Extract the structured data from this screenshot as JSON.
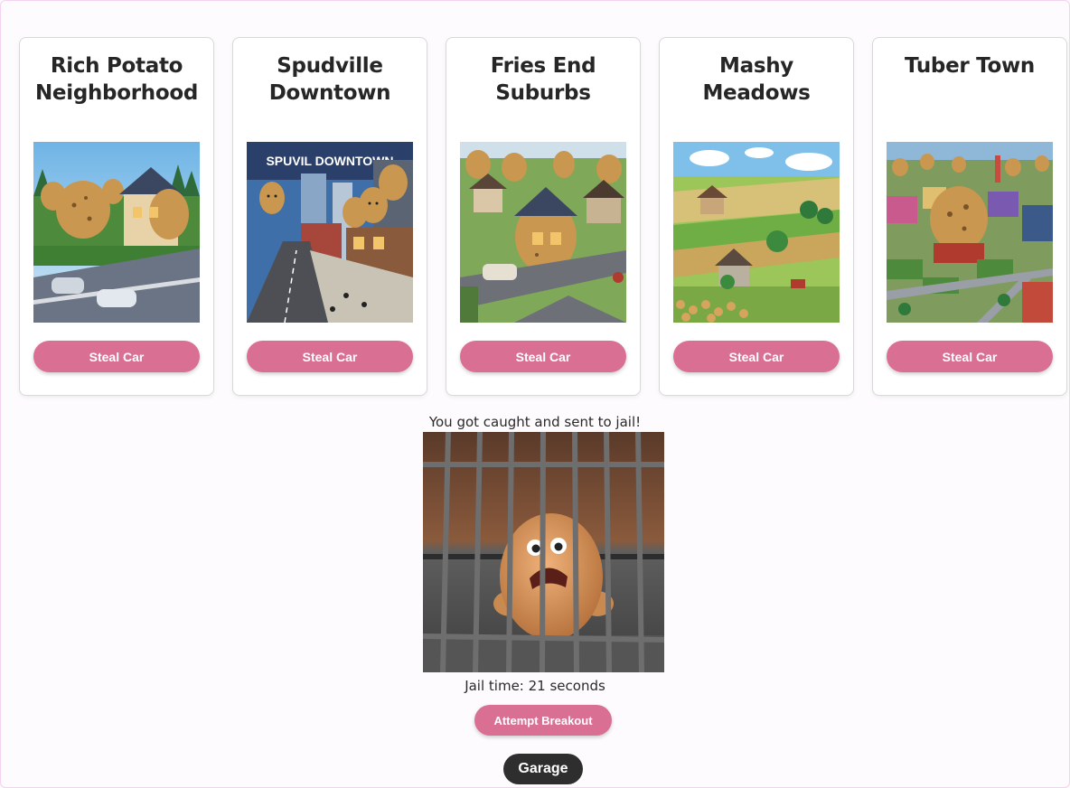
{
  "neighborhoods": [
    {
      "title": "Rich Potato Neighborhood",
      "button": "Steal Car"
    },
    {
      "title": "Spudville Downtown",
      "button": "Steal Car",
      "sign": "SPUVIL DOWNTOWN"
    },
    {
      "title": "Fries End Suburbs",
      "button": "Steal Car"
    },
    {
      "title": "Mashy Meadows",
      "button": "Steal Car"
    },
    {
      "title": "Tuber Town",
      "button": "Steal Car"
    }
  ],
  "jail": {
    "message": "You got caught and sent to jail!",
    "time_text": "Jail time: 21 seconds",
    "breakout_label": "Attempt Breakout"
  },
  "garage_label": "Garage",
  "colors": {
    "accent": "#d97093",
    "dark_button": "#2e2e2e",
    "card_border": "#d9d9d9"
  }
}
